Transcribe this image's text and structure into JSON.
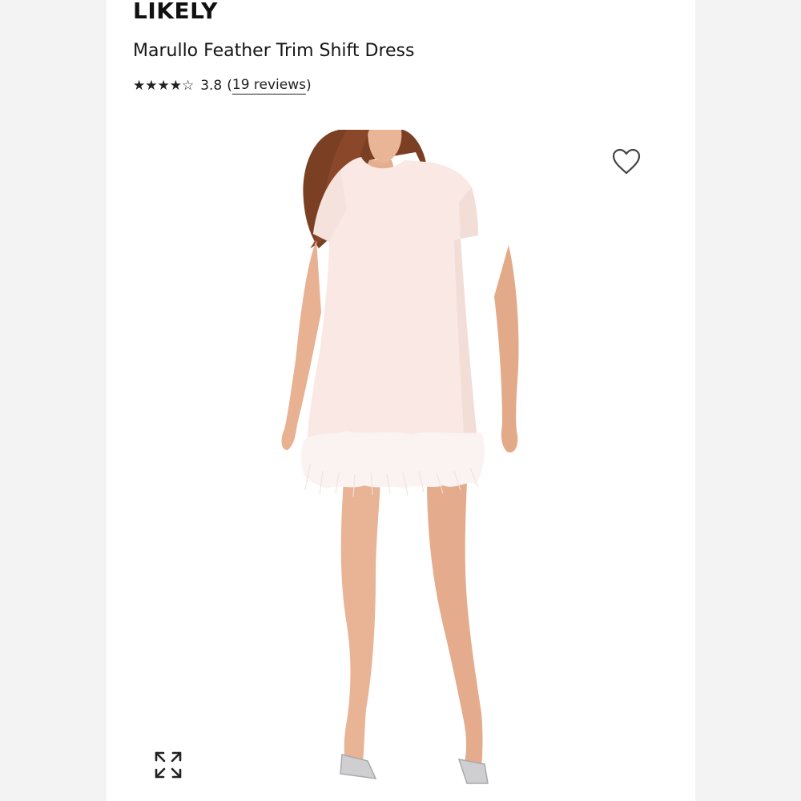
{
  "header": {
    "brand": "LIKELY",
    "product_title": "Marullo Feather Trim Shift Dress"
  },
  "rating": {
    "stars": "★★★★☆",
    "value": "3.8",
    "reviews_open": "(",
    "reviews_link": "19 reviews",
    "reviews_close": ")",
    "score_out_of_5": 3.8
  },
  "icons": {
    "wishlist": "heart-outline-icon",
    "expand": "expand-arrows-icon"
  },
  "colors": {
    "text": "#111111",
    "dress": "#f8e7e3",
    "skin": "#e9b394",
    "hair": "#7a3d22",
    "background": "#ffffff"
  }
}
